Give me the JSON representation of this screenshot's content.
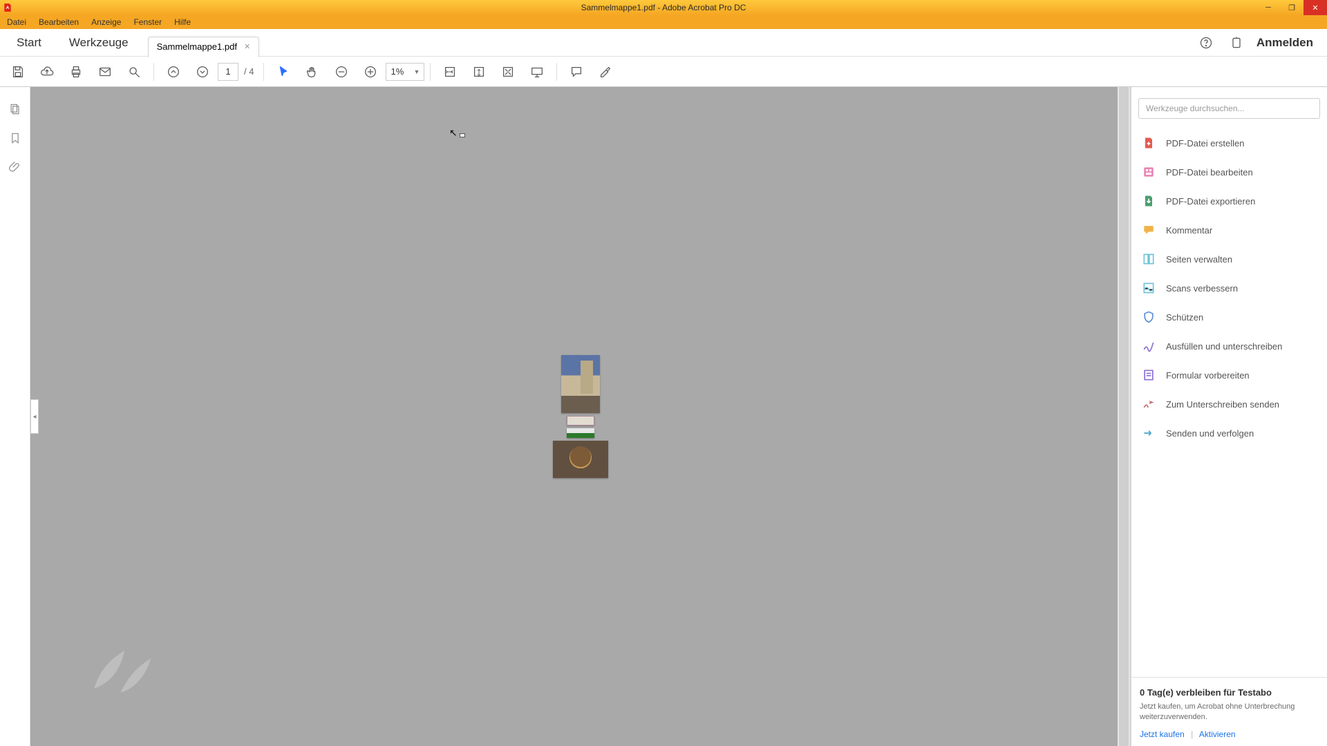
{
  "titlebar": {
    "title": "Sammelmappe1.pdf - Adobe Acrobat Pro DC"
  },
  "menubar": {
    "items": [
      "Datei",
      "Bearbeiten",
      "Anzeige",
      "Fenster",
      "Hilfe"
    ]
  },
  "tabs": {
    "start": "Start",
    "tools": "Werkzeuge",
    "doc": "Sammelmappe1.pdf",
    "signin": "Anmelden"
  },
  "toolbar": {
    "page_current": "1",
    "page_total": "/ 4",
    "zoom_value": "1%"
  },
  "right_panel": {
    "search_placeholder": "Werkzeuge durchsuchen...",
    "tools": [
      {
        "label": "PDF-Datei erstellen",
        "icon": "create",
        "color": "#E35B4F"
      },
      {
        "label": "PDF-Datei bearbeiten",
        "icon": "edit",
        "color": "#E77FB1"
      },
      {
        "label": "PDF-Datei exportieren",
        "icon": "export",
        "color": "#4A9E6E"
      },
      {
        "label": "Kommentar",
        "icon": "comment",
        "color": "#F1B24A"
      },
      {
        "label": "Seiten verwalten",
        "icon": "pages",
        "color": "#6FC3D8"
      },
      {
        "label": "Scans verbessern",
        "icon": "enhance",
        "color": "#6FC3D8"
      },
      {
        "label": "Schützen",
        "icon": "protect",
        "color": "#5E8FD6"
      },
      {
        "label": "Ausfüllen und unterschreiben",
        "icon": "fillsign",
        "color": "#8C6FD6"
      },
      {
        "label": "Formular vorbereiten",
        "icon": "form",
        "color": "#8C6FD6"
      },
      {
        "label": "Zum Unterschreiben senden",
        "icon": "sendsign",
        "color": "#C06F6F"
      },
      {
        "label": "Senden und verfolgen",
        "icon": "sendtrack",
        "color": "#4AA2C8"
      }
    ]
  },
  "trial": {
    "title": "0 Tag(e) verbleiben für Testabo",
    "subtitle": "Jetzt kaufen, um Acrobat ohne Unterbrechung weiterzuverwenden.",
    "buy": "Jetzt kaufen",
    "activate": "Aktivieren"
  }
}
